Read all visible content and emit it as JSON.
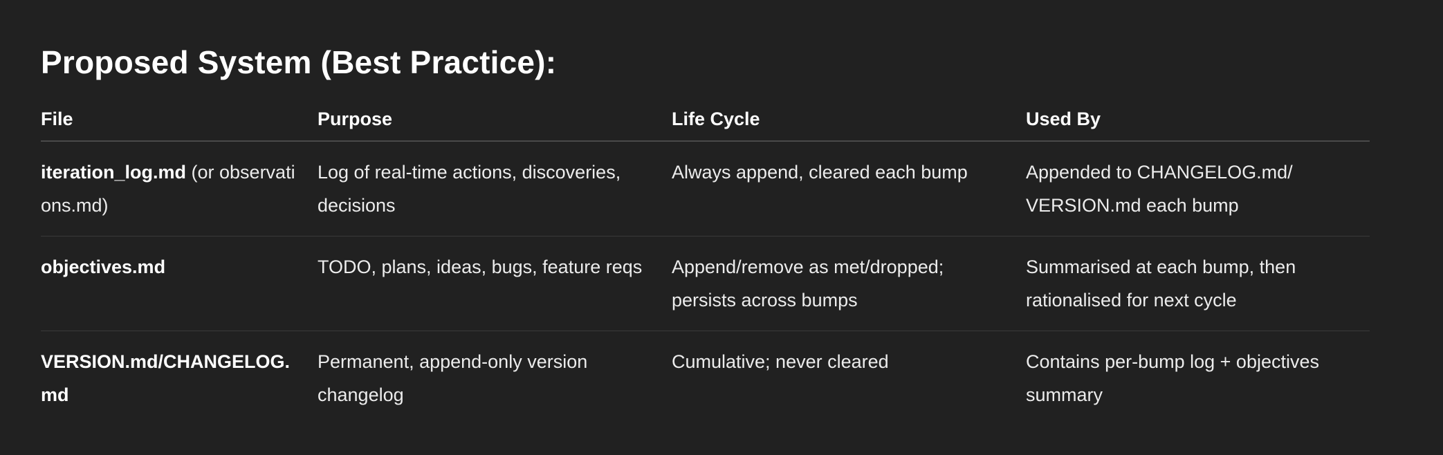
{
  "heading": "Proposed System (Best Practice):",
  "table": {
    "headers": [
      "File",
      "Purpose",
      "Life Cycle",
      "Used By"
    ],
    "rows": [
      {
        "file_bold": "iteration_log.md",
        "file_rest": " (or observations.md)",
        "purpose": "Log of real-time actions, discoveries, decisions",
        "lifecycle": "Always append, cleared each bump",
        "usedby": "Appended to CHANGELOG.md/ VERSION.md each bump"
      },
      {
        "file_bold": "objectives.md",
        "file_rest": "",
        "purpose": "TODO, plans, ideas, bugs, feature reqs",
        "lifecycle": "Append/remove as met/dropped; persists across bumps",
        "usedby": "Summarised at each bump, then rationalised for next cycle"
      },
      {
        "file_bold": "VERSION.md/CHANGELOG.md",
        "file_rest": "",
        "purpose": "Permanent, append-only version changelog",
        "lifecycle": "Cumulative; never cleared",
        "usedby": "Contains per-bump log + objectives summary"
      }
    ]
  }
}
